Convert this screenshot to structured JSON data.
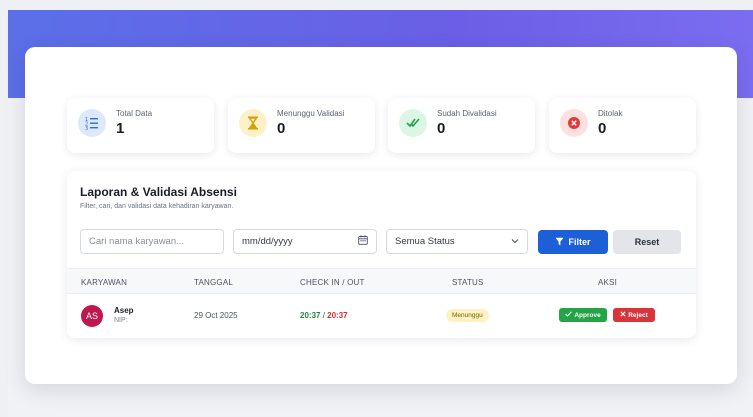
{
  "stats": [
    {
      "label": "Total Data",
      "value": "1",
      "icon": "list-icon",
      "icon_bg": "#dde8fb",
      "icon_color": "#2f6be0"
    },
    {
      "label": "Menunggu Validasi",
      "value": "0",
      "icon": "hourglass-icon",
      "icon_bg": "#fdf1c7",
      "icon_color": "#d4a00c"
    },
    {
      "label": "Sudah Divalidasi",
      "value": "0",
      "icon": "double-check-icon",
      "icon_bg": "#dcf5e4",
      "icon_color": "#27a04a"
    },
    {
      "label": "Ditolak",
      "value": "0",
      "icon": "x-circle-icon",
      "icon_bg": "#fde0e0",
      "icon_color": "#e23a3a"
    }
  ],
  "report": {
    "title": "Laporan & Validasi Absensi",
    "subtitle": "Filter, cari, dan validasi data kehadiran karyawan."
  },
  "filters": {
    "search_placeholder": "Cari nama karyawan...",
    "date_placeholder": "mm/dd/yyyy",
    "status_selected": "Semua Status",
    "filter_label": "Filter",
    "reset_label": "Reset"
  },
  "table": {
    "headers": [
      "KARYAWAN",
      "TANGGAL",
      "CHECK IN / OUT",
      "STATUS",
      "AKSI"
    ],
    "rows": [
      {
        "initials": "AS",
        "name": "Asep",
        "nip": "NIP:",
        "date": "29 Oct 2025",
        "check_in": "20:37",
        "separator": " / ",
        "check_out": "20:37",
        "status": "Menunggu",
        "approve_label": "Approve",
        "reject_label": "Reject"
      }
    ]
  },
  "colors": {
    "banner": "#5b6fe8",
    "primary": "#1d5fd6",
    "approve": "#22a447",
    "reject": "#d9343a",
    "pending_badge": "#fff2c2"
  }
}
